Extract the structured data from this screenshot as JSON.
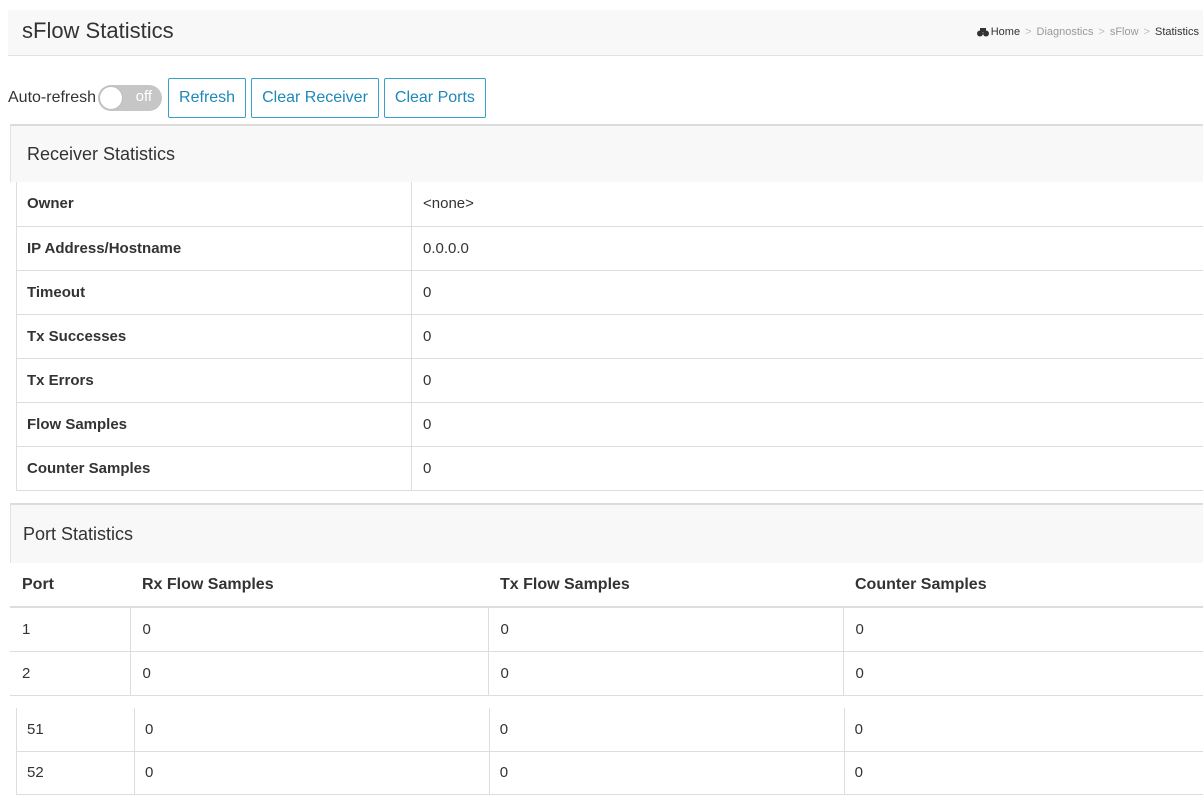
{
  "header": {
    "title": "sFlow Statistics",
    "breadcrumb": [
      "Home",
      "Diagnostics",
      "sFlow",
      "Statistics"
    ],
    "breadcrumb_sep": ">"
  },
  "toolbar": {
    "auto_refresh_label": "Auto-refresh",
    "auto_refresh_state": "off",
    "refresh_label": "Refresh",
    "clear_receiver_label": "Clear Receiver",
    "clear_ports_label": "Clear Ports"
  },
  "receiver": {
    "title": "Receiver Statistics",
    "rows": [
      {
        "key": "Owner",
        "value": "<none>"
      },
      {
        "key": "IP Address/Hostname",
        "value": "0.0.0.0"
      },
      {
        "key": "Timeout",
        "value": "0"
      },
      {
        "key": "Tx Successes",
        "value": "0"
      },
      {
        "key": "Tx Errors",
        "value": "0"
      },
      {
        "key": "Flow Samples",
        "value": "0"
      },
      {
        "key": "Counter Samples",
        "value": "0"
      }
    ]
  },
  "ports": {
    "title": "Port Statistics",
    "columns": [
      "Port",
      "Rx Flow Samples",
      "Tx Flow Samples",
      "Counter Samples"
    ],
    "rows": [
      [
        "1",
        "0",
        "0",
        "0"
      ],
      [
        "2",
        "0",
        "0",
        "0"
      ]
    ],
    "rows_tail": [
      [
        "51",
        "0",
        "0",
        "0"
      ],
      [
        "52",
        "0",
        "0",
        "0"
      ]
    ]
  },
  "colors": {
    "accent": "#1e88b8",
    "header_bg": "#f8f8f8",
    "toggle_off": "#c6c6c6"
  }
}
